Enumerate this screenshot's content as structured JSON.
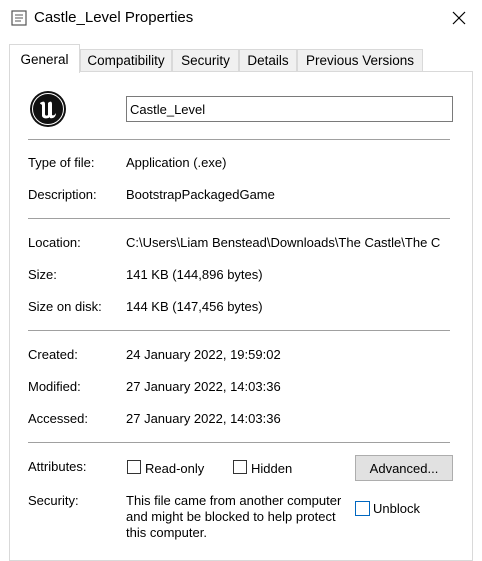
{
  "window": {
    "title": "Castle_Level Properties"
  },
  "tabs": [
    {
      "label": "General"
    },
    {
      "label": "Compatibility"
    },
    {
      "label": "Security"
    },
    {
      "label": "Details"
    },
    {
      "label": "Previous Versions"
    }
  ],
  "general": {
    "file_name": "Castle_Level",
    "type_label": "Type of file:",
    "type_value": "Application (.exe)",
    "description_label": "Description:",
    "description_value": "BootstrapPackagedGame",
    "location_label": "Location:",
    "location_value": "C:\\Users\\Liam Benstead\\Downloads\\The Castle\\The C",
    "size_label": "Size:",
    "size_value": "141 KB (144,896 bytes)",
    "size_on_disk_label": "Size on disk:",
    "size_on_disk_value": "144 KB (147,456 bytes)",
    "created_label": "Created:",
    "created_value": "24 January 2022, 19:59:02",
    "modified_label": "Modified:",
    "modified_value": "27 January 2022, 14:03:36",
    "accessed_label": "Accessed:",
    "accessed_value": "27 January 2022, 14:03:36",
    "attributes_label": "Attributes:",
    "readonly_label": "Read-only",
    "hidden_label": "Hidden",
    "advanced_button": "Advanced...",
    "security_label": "Security:",
    "security_text_1": "This file came from another computer",
    "security_text_2": "and might be blocked to help protect",
    "security_text_3": "this computer.",
    "unblock_label": "Unblock"
  }
}
